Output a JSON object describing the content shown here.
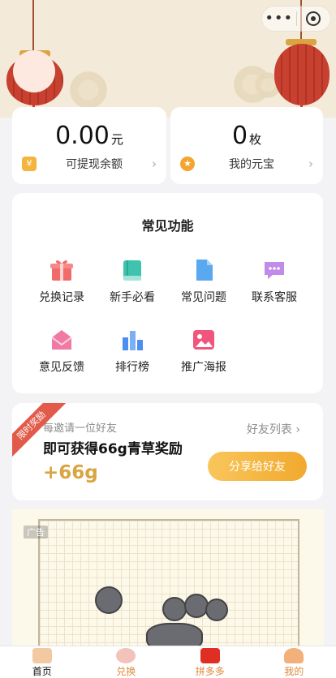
{
  "balance": {
    "cash_value": "0.00",
    "cash_unit": "元",
    "cash_label": "可提现余额",
    "ingot_value": "0",
    "ingot_unit": "枚",
    "ingot_label": "我的元宝"
  },
  "features": {
    "title": "常见功能",
    "items": [
      {
        "label": "兑换记录",
        "icon": "gift-icon"
      },
      {
        "label": "新手必看",
        "icon": "book-icon"
      },
      {
        "label": "常见问题",
        "icon": "document-icon"
      },
      {
        "label": "联系客服",
        "icon": "chat-icon"
      },
      {
        "label": "意见反馈",
        "icon": "envelope-icon"
      },
      {
        "label": "排行榜",
        "icon": "bar-chart-icon"
      },
      {
        "label": "推广海报",
        "icon": "image-icon"
      }
    ]
  },
  "invite": {
    "ribbon": "限时奖励",
    "subtitle": "每邀请一位好友",
    "title": "即可获得66g青草奖励",
    "amount": "+66g",
    "friends_link": "好友列表",
    "share_button": "分享给好友"
  },
  "ad": {
    "label": "广告"
  },
  "tabbar": [
    {
      "label": "首页",
      "icon": "home-gift-icon",
      "active": true
    },
    {
      "label": "兑换",
      "icon": "exchange-icon",
      "active": false
    },
    {
      "label": "拼多多",
      "icon": "pinduoduo-icon",
      "active": false
    },
    {
      "label": "我的",
      "icon": "profile-icon",
      "active": false
    }
  ],
  "colors": {
    "accent": "#f1a92d",
    "amount": "#d9a441",
    "ribbon": "#e25a4a",
    "tab_active": "#111111",
    "tab_inactive": "#e08a3c"
  }
}
